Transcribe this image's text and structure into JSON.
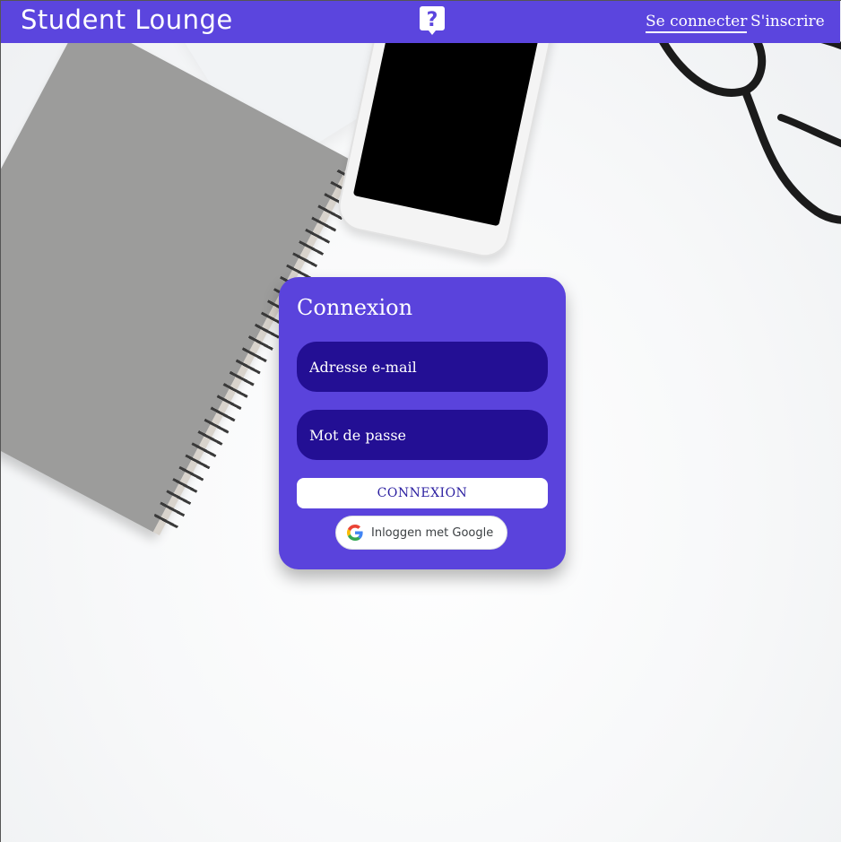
{
  "header": {
    "brand": "Student Lounge",
    "logo_icon": "question-bubble-icon",
    "nav": {
      "login_label": "Se connecter",
      "signup_label": "S'inscrire"
    }
  },
  "login_card": {
    "title": "Connexion",
    "email": {
      "placeholder": "Adresse e-mail",
      "value": ""
    },
    "password": {
      "placeholder": "Mot de passe",
      "value": ""
    },
    "submit_label": "CONNEXION",
    "google_label": "Inloggen met Google",
    "google_icon": "google-icon"
  },
  "colors": {
    "primary": "#5b45de",
    "input_bg": "#230f94",
    "button_text": "#2a1ea0",
    "text_light": "#ffffff"
  }
}
